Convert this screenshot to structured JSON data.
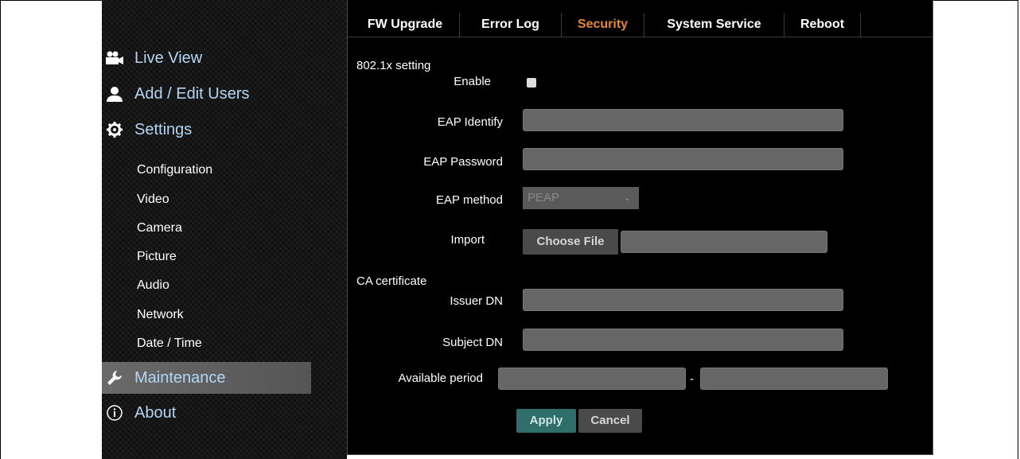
{
  "sidebar": {
    "main_items": [
      {
        "label": "Live View",
        "icon": "camera-icon"
      },
      {
        "label": "Add / Edit Users",
        "icon": "user-icon"
      },
      {
        "label": "Settings",
        "icon": "gear-icon"
      },
      {
        "label": "Maintenance",
        "icon": "wrench-icon"
      },
      {
        "label": "About",
        "icon": "info-icon"
      }
    ],
    "sub_items": [
      "Configuration",
      "Video",
      "Camera",
      "Picture",
      "Audio",
      "Network",
      "Date / Time"
    ],
    "active_item": "Maintenance"
  },
  "tabs": [
    {
      "label": "FW Upgrade"
    },
    {
      "label": "Error Log"
    },
    {
      "label": "Security",
      "active": true
    },
    {
      "label": "System Service"
    },
    {
      "label": "Reboot"
    }
  ],
  "form": {
    "section_8021x": "802.1x setting",
    "enable_label": "Enable",
    "enable_checked": false,
    "eap_identify_label": "EAP Identify",
    "eap_identify_value": "",
    "eap_password_label": "EAP Password",
    "eap_password_value": "",
    "eap_method_label": "EAP method",
    "eap_method_value": "PEAP",
    "import_label": "Import",
    "choose_file_label": "Choose File",
    "file_name_value": "",
    "section_ca": "CA certificate",
    "issuer_dn_label": "Issuer DN",
    "issuer_dn_value": "",
    "subject_dn_label": "Subject DN",
    "subject_dn_value": "",
    "available_period_label": "Available period",
    "period_start_value": "",
    "period_separator": "-",
    "period_end_value": ""
  },
  "buttons": {
    "apply_label": "Apply",
    "cancel_label": "Cancel"
  },
  "colors": {
    "active_tab": "#e8862a",
    "nav_text": "#b3d6f2",
    "apply_button": "#2f6e6a",
    "cancel_button": "#4a4a4a"
  }
}
